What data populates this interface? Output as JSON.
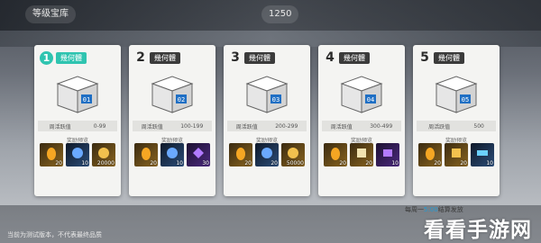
{
  "topbar": {
    "chip_left": "等级宝库",
    "chip_right": "1250"
  },
  "cards": [
    {
      "num": "1",
      "tag": "幾何體",
      "code": "01",
      "range_label": "周活跃值",
      "range": "0-99",
      "reward_label": "奖励预览",
      "rewards": [
        {
          "kind": "gold",
          "count": "20"
        },
        {
          "kind": "blue",
          "count": "10"
        },
        {
          "kind": "gold",
          "count": "20000"
        }
      ]
    },
    {
      "num": "2",
      "tag": "幾何體",
      "code": "02",
      "range_label": "周活跃值",
      "range": "100-199",
      "reward_label": "奖励预览",
      "rewards": [
        {
          "kind": "gold",
          "count": "20"
        },
        {
          "kind": "blue",
          "count": "10"
        },
        {
          "kind": "purple",
          "count": "30"
        }
      ]
    },
    {
      "num": "3",
      "tag": "幾何體",
      "code": "03",
      "range_label": "周活跃值",
      "range": "200-299",
      "reward_label": "奖励预览",
      "rewards": [
        {
          "kind": "gold",
          "count": "20"
        },
        {
          "kind": "blue",
          "count": "20"
        },
        {
          "kind": "gold",
          "count": "50000"
        }
      ]
    },
    {
      "num": "4",
      "tag": "幾何體",
      "code": "04",
      "range_label": "周活跃值",
      "range": "300-499",
      "reward_label": "奖励预览",
      "rewards": [
        {
          "kind": "gold",
          "count": "20"
        },
        {
          "kind": "gold",
          "count": "20"
        },
        {
          "kind": "purple",
          "count": "10"
        }
      ]
    },
    {
      "num": "5",
      "tag": "幾何體",
      "code": "05",
      "range_label": "周活跃值",
      "range": "500",
      "reward_label": "奖励预览",
      "rewards": [
        {
          "kind": "gold",
          "count": "20"
        },
        {
          "kind": "gold",
          "count": "20"
        },
        {
          "kind": "blue",
          "count": "10"
        }
      ]
    }
  ],
  "refresh_note": {
    "prefix": "每周一",
    "time": "5:00",
    "suffix": "结算发放"
  },
  "disclaimer": "当前为测试版本，不代表最终品质",
  "watermark": "看看手游网",
  "colors": {
    "accent": "#2fc4b0",
    "card_bg": "#f4f4f2"
  }
}
